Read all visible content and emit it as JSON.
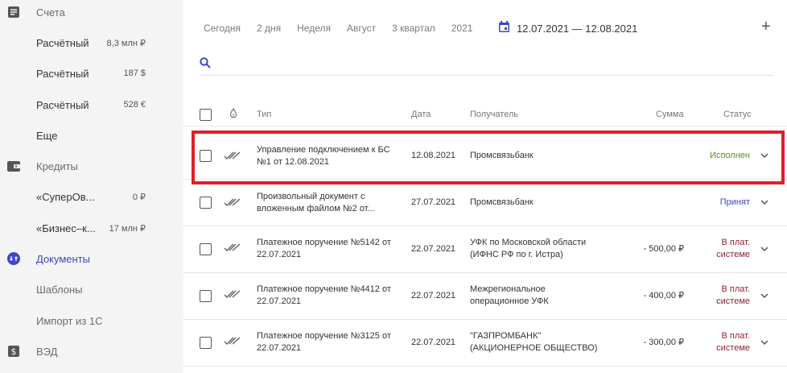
{
  "sidebar": {
    "accounts_label": "Счета",
    "accounts": [
      {
        "label": "Расчётный",
        "amount": "8,3 млн ₽"
      },
      {
        "label": "Расчётный",
        "amount": "187 $"
      },
      {
        "label": "Расчётный",
        "amount": "528 €"
      }
    ],
    "more_label": "Еще",
    "credits_label": "Кредиты",
    "credits": [
      {
        "label": "«СуперОв...",
        "amount": "0 ₽"
      },
      {
        "label": "«Бизнес–к...",
        "amount": "17 млн ₽"
      }
    ],
    "documents_label": "Документы",
    "templates_label": "Шаблоны",
    "import_label": "Импорт из 1С",
    "ved_label": "ВЭД",
    "colors": {
      "active": "#3b47c4",
      "background": "#f4f4f5"
    }
  },
  "filters": {
    "periods": [
      "Сегодня",
      "2 дня",
      "Неделя",
      "Август",
      "3 квартал",
      "2021"
    ],
    "date_range": "12.07.2021 — 12.08.2021",
    "add_label": "+"
  },
  "search": {
    "placeholder": ""
  },
  "table": {
    "columns": {
      "type": "Тип",
      "date": "Дата",
      "recipient": "Получатель",
      "sum": "Сумма",
      "status": "Статус"
    },
    "rows": [
      {
        "type": "Управление подключением к БС №1 от 12.08.2021",
        "date": "12.08.2021",
        "recipient": "Промсвязьбанк",
        "sum": "",
        "status": "Исполнен",
        "status_kind": "done"
      },
      {
        "type": "Произвольный документ с вложенным файлом №2 от...",
        "date": "27.07.2021",
        "recipient": "Промсвязьбанк",
        "sum": "",
        "status": "Принят",
        "status_kind": "accepted"
      },
      {
        "type": "Платежное поручение №5142 от 22.07.2021",
        "date": "22.07.2021",
        "recipient": "УФК по Московской области (ИФНС РФ по г. Истра)",
        "sum": "- 500,00 ₽",
        "status": "В плат. системе",
        "status_kind": "system"
      },
      {
        "type": "Платежное поручение №4412 от 22.07.2021",
        "date": "22.07.2021",
        "recipient": "Межрегиональное операционное УФК",
        "sum": "- 400,00 ₽",
        "status": "В плат. системе",
        "status_kind": "system"
      },
      {
        "type": "Платежное поручение №3125 от 22.07.2021",
        "date": "22.07.2021",
        "recipient": "\"ГАЗПРОМБАНК\" (АКЦИОНЕРНОЕ ОБЩЕСТВО)",
        "sum": "- 300,00 ₽",
        "status": "В плат. системе",
        "status_kind": "system"
      }
    ],
    "status_colors": {
      "done": "#5a8a2a",
      "accepted": "#3b47c4",
      "system": "#8b2233"
    }
  },
  "highlight_color": "#e11f26"
}
